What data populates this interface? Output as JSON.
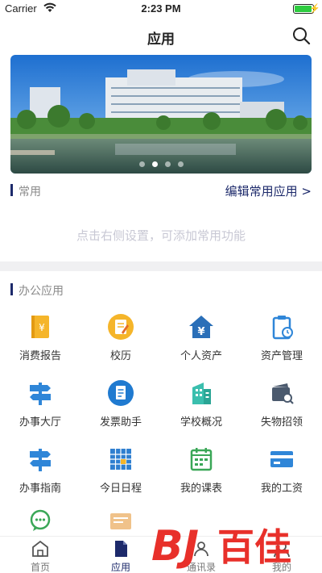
{
  "status": {
    "carrier": "Carrier",
    "time": "2:23 PM",
    "battery_level": 0.95
  },
  "nav": {
    "title": "应用"
  },
  "banner": {
    "slides": 4,
    "active_slide": 1
  },
  "common": {
    "label": "常用",
    "edit_label": "编辑常用应用 >",
    "empty_hint": "点击右侧设置，可添加常用功能"
  },
  "office": {
    "label": "办公应用",
    "apps": [
      {
        "label": "消费报告",
        "icon": "report-icon"
      },
      {
        "label": "校历",
        "icon": "calendar-note-icon"
      },
      {
        "label": "个人资产",
        "icon": "house-yen-icon"
      },
      {
        "label": "资产管理",
        "icon": "clipboard-clock-icon"
      },
      {
        "label": "办事大厅",
        "icon": "signpost-icon"
      },
      {
        "label": "发票助手",
        "icon": "invoice-icon"
      },
      {
        "label": "学校概况",
        "icon": "building-icon"
      },
      {
        "label": "失物招领",
        "icon": "wallet-search-icon"
      },
      {
        "label": "办事指南",
        "icon": "signpost-icon"
      },
      {
        "label": "今日日程",
        "icon": "schedule-icon"
      },
      {
        "label": "我的课表",
        "icon": "timetable-icon"
      },
      {
        "label": "我的工资",
        "icon": "card-icon"
      }
    ]
  },
  "tabs": [
    {
      "label": "首页",
      "icon": "home-icon"
    },
    {
      "label": "应用",
      "icon": "apps-icon"
    },
    {
      "label": "通讯录",
      "icon": "contacts-icon"
    },
    {
      "label": "我的",
      "icon": "profile-icon"
    }
  ],
  "colors": {
    "accent": "#1d2a6b",
    "orange": "#f5b52a",
    "blue": "#2f86d8",
    "teal": "#3bbfae",
    "green": "#3aa757"
  }
}
